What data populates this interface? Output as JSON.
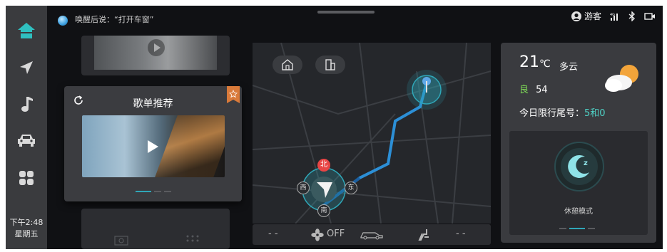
{
  "voice_hint": "唤醒后说：“打开车窗”",
  "status": {
    "user": "游客"
  },
  "clock": {
    "time": "下午2:48",
    "weekday": "星期五"
  },
  "music": {
    "title": "歌单推荐"
  },
  "map": {
    "compass": {
      "north": "北",
      "south": "南",
      "east": "东",
      "west": "西"
    }
  },
  "climate": {
    "left_temp": "- -",
    "fan": "OFF",
    "right_temp": "- -"
  },
  "weather": {
    "temp": "21",
    "unit": "℃",
    "condition": "多云",
    "aqi_level": "良",
    "aqi_value": "54",
    "plate_label": "今日限行尾号：",
    "plate_value": "5和0"
  },
  "rest_mode": {
    "label": "休憩模式"
  },
  "colors": {
    "accent": "#2fa7b8",
    "aqi_good": "#7ed957",
    "plate": "#4fd1c5",
    "route": "#2c8fd6",
    "north": "#e84545",
    "star": "#d97a3a"
  }
}
